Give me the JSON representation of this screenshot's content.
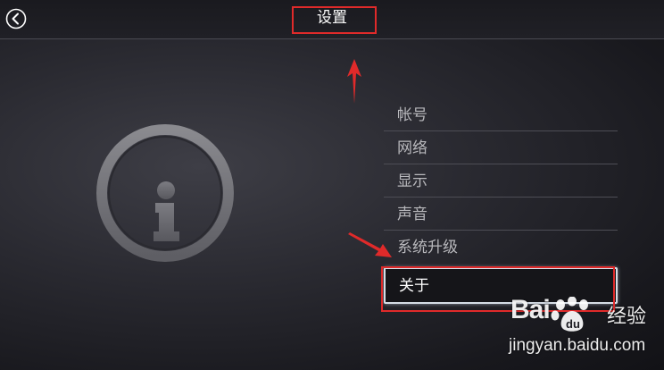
{
  "header": {
    "title": "设置",
    "back_icon": "back-arrow-circle-icon"
  },
  "hero_icon": "info-icon",
  "menu": {
    "items": [
      {
        "label": "帐号",
        "selected": false
      },
      {
        "label": "网络",
        "selected": false
      },
      {
        "label": "显示",
        "selected": false
      },
      {
        "label": "声音",
        "selected": false
      },
      {
        "label": "系统升级",
        "selected": false
      },
      {
        "label": "关于",
        "selected": true
      }
    ]
  },
  "annotations": {
    "color": "#e02a2a"
  },
  "watermark": {
    "logo_left": "Bai",
    "logo_right": "经验",
    "url": "jingyan.baidu.com"
  }
}
